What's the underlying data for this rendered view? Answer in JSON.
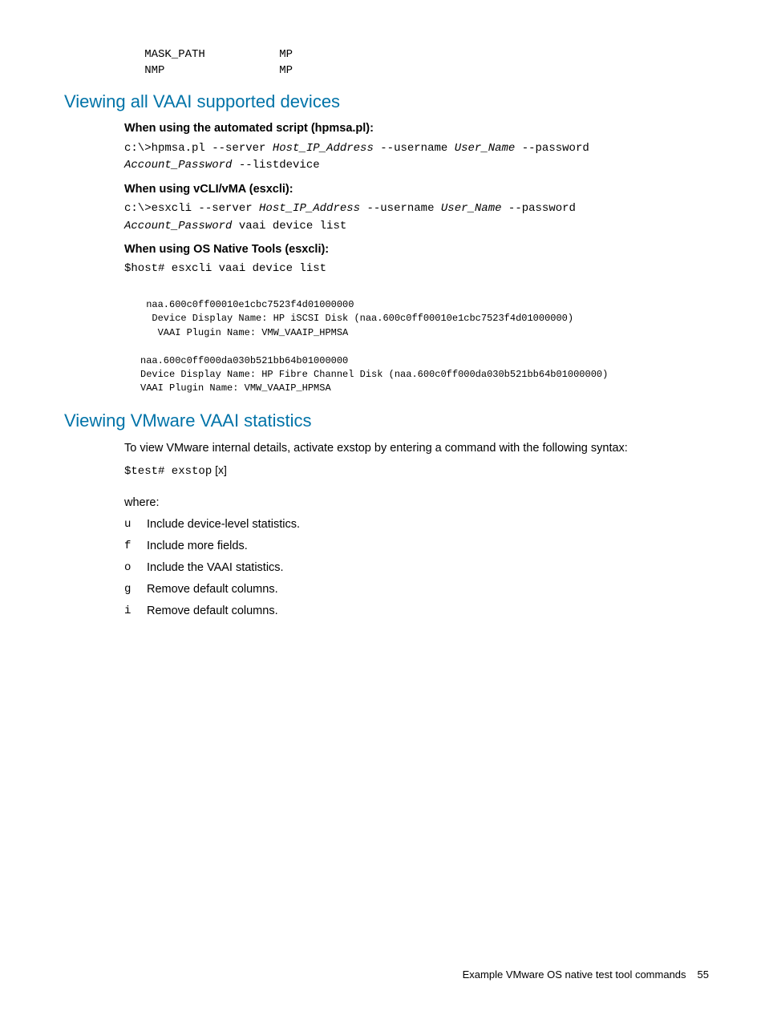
{
  "top_code": "   MASK_PATH           MP\n   NMP                 MP",
  "section1": {
    "heading": "Viewing all VAAI supported devices",
    "sub1": "When using the automated script (hpmsa.pl):",
    "cmd1_a": "c:\\>hpmsa.pl --server ",
    "cmd1_b": "Host_IP_Address",
    "cmd1_c": " --username ",
    "cmd1_d": "User_Name",
    "cmd1_e": " --password",
    "cmd1_f": "Account_Password",
    "cmd1_g": " --listdevice",
    "sub2": "When using vCLI/vMA (esxcli):",
    "cmd2_a": "c:\\>esxcli --server ",
    "cmd2_b": "Host_IP_Address",
    "cmd2_c": " --username ",
    "cmd2_d": "User_Name",
    "cmd2_e": " --password",
    "cmd2_f": "Account_Password",
    "cmd2_g": " vaai device list",
    "sub3": "When using OS Native Tools (esxcli):",
    "cmd3": "$host# esxcli vaai device list",
    "output": " naa.600c0ff00010e1cbc7523f4d01000000\n  Device Display Name: HP iSCSI Disk (naa.600c0ff00010e1cbc7523f4d01000000)\n   VAAI Plugin Name: VMW_VAAIP_HPMSA\n\nnaa.600c0ff000da030b521bb64b01000000\nDevice Display Name: HP Fibre Channel Disk (naa.600c0ff000da030b521bb64b01000000)\nVAAI Plugin Name: VMW_VAAIP_HPMSA"
  },
  "section2": {
    "heading": "Viewing VMware VAAI statistics",
    "intro": "To view VMware internal details, activate exstop by entering a command with the following syntax:",
    "cmd_a": "$test# exstop",
    "cmd_b": " [x]",
    "where_label": "where:",
    "options": [
      {
        "key": "u",
        "desc": "Include device-level statistics."
      },
      {
        "key": "f",
        "desc": "Include more fields."
      },
      {
        "key": "o",
        "desc": "Include the VAAI statistics."
      },
      {
        "key": "g",
        "desc": "Remove default columns."
      },
      {
        "key": "i",
        "desc": "Remove default columns."
      }
    ]
  },
  "footer": {
    "text": "Example VMware OS native test tool commands",
    "page": "55"
  }
}
